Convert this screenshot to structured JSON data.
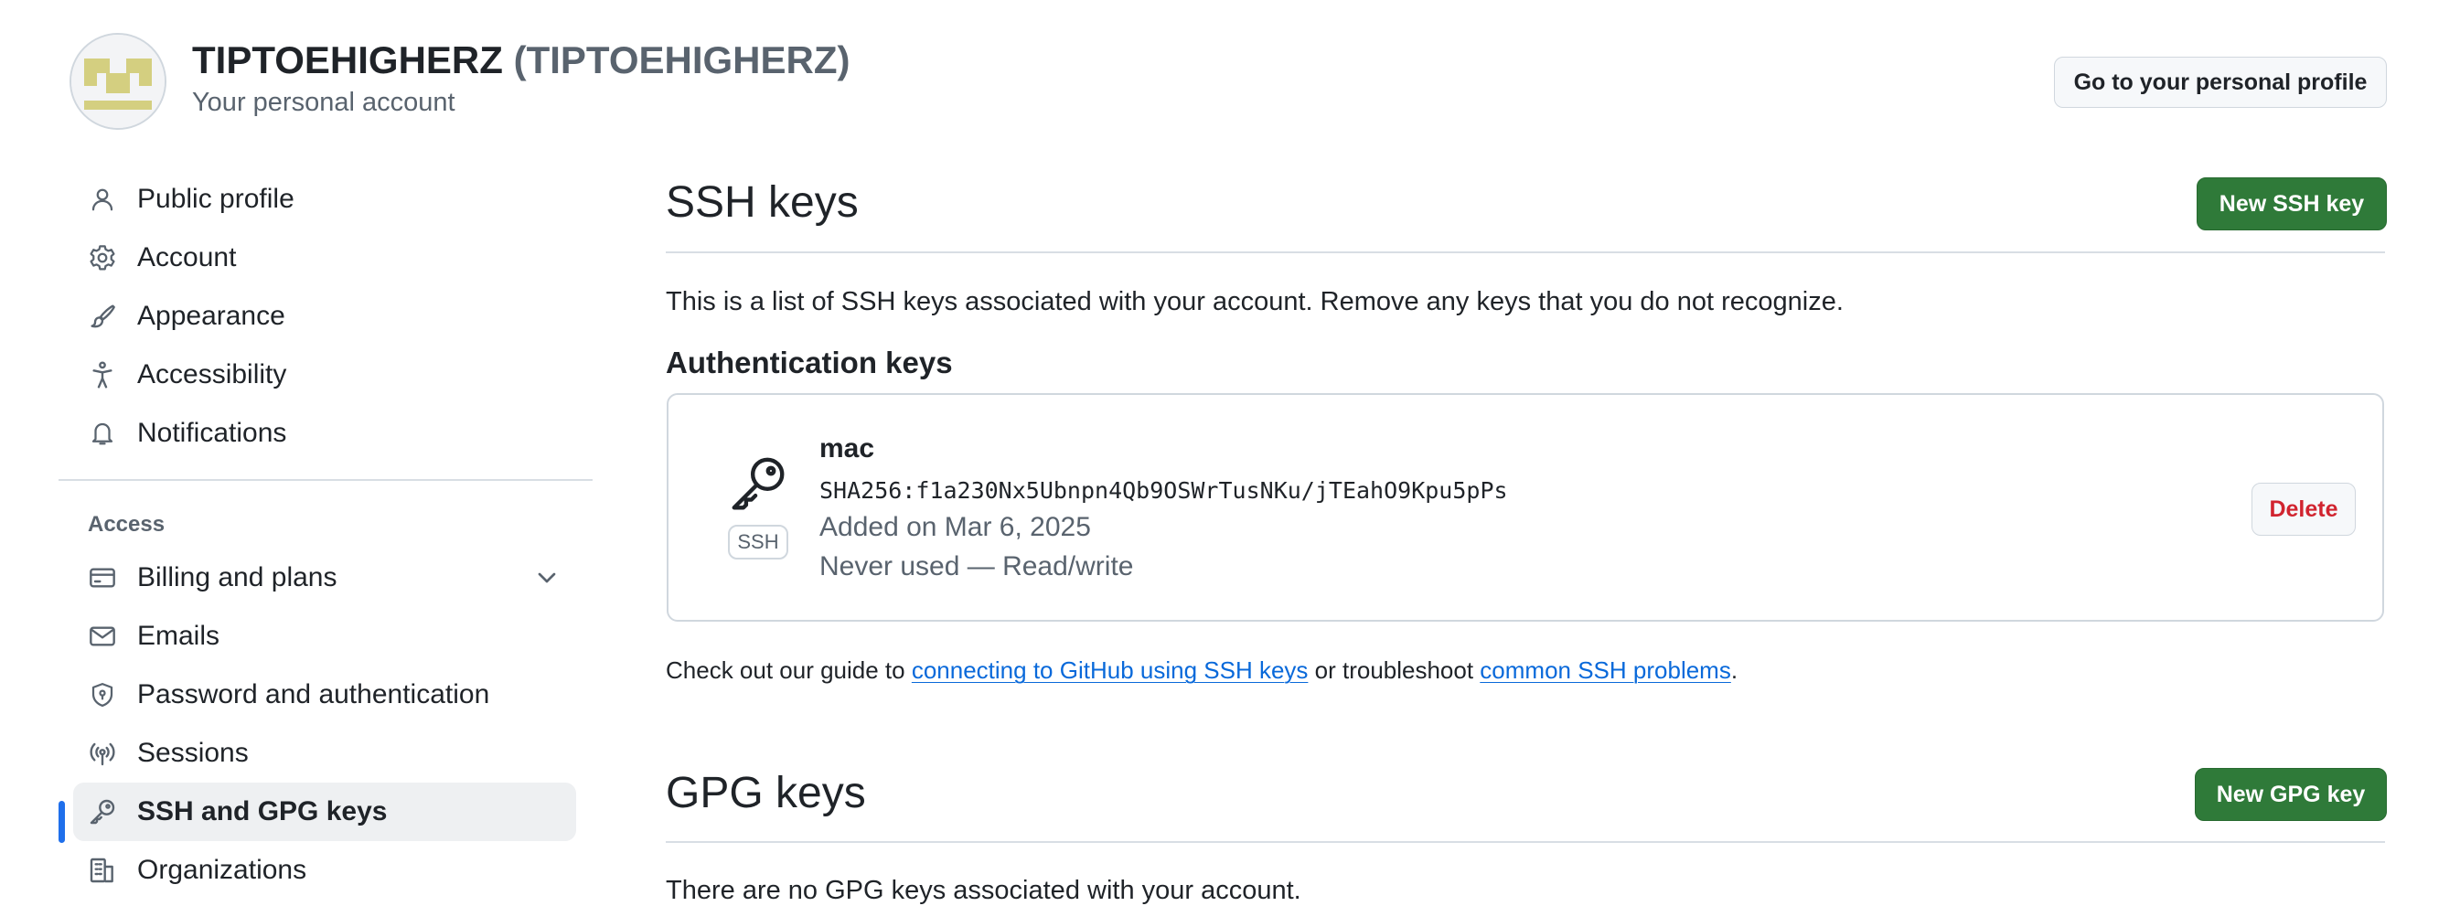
{
  "header": {
    "name": "TIPTOEHIGHERZ",
    "login": "(TIPTOEHIGHERZ)",
    "subtitle": "Your personal account",
    "profile_button": "Go to your personal profile"
  },
  "sidebar": {
    "items": [
      {
        "label": "Public profile",
        "icon": "person-icon"
      },
      {
        "label": "Account",
        "icon": "gear-icon"
      },
      {
        "label": "Appearance",
        "icon": "paintbrush-icon"
      },
      {
        "label": "Accessibility",
        "icon": "accessibility-icon"
      },
      {
        "label": "Notifications",
        "icon": "bell-icon"
      }
    ],
    "access_heading": "Access",
    "access_items": [
      {
        "label": "Billing and plans",
        "icon": "credit-card-icon"
      },
      {
        "label": "Emails",
        "icon": "mail-icon"
      },
      {
        "label": "Password and authentication",
        "icon": "shield-lock-icon"
      },
      {
        "label": "Sessions",
        "icon": "broadcast-icon"
      },
      {
        "label": "SSH and GPG keys",
        "icon": "key-icon",
        "active": true
      },
      {
        "label": "Organizations",
        "icon": "organization-icon"
      }
    ]
  },
  "ssh": {
    "title": "SSH keys",
    "new_button": "New SSH key",
    "description": "This is a list of SSH keys associated with your account. Remove any keys that you do not recognize.",
    "auth_heading": "Authentication keys",
    "keys": [
      {
        "name": "mac",
        "fingerprint": "SHA256:f1a230Nx5Ubnpn4Qb9OSWrTusNKu/jTEahO9Kpu5pPs",
        "added": "Added on Mar 6, 2025",
        "usage": "Never used — Read/write",
        "badge": "SSH",
        "delete_label": "Delete"
      }
    ],
    "guide_prefix": "Check out our guide to ",
    "guide_link1": "connecting to GitHub using SSH keys",
    "guide_middle": " or troubleshoot ",
    "guide_link2": "common SSH problems",
    "guide_suffix": "."
  },
  "gpg": {
    "title": "GPG keys",
    "new_button": "New GPG key",
    "empty_text": "There are no GPG keys associated with your account."
  },
  "colors": {
    "accent": "#1f6feb",
    "primary_button": "#2f7a39",
    "danger": "#d1242f",
    "link": "#0969da"
  }
}
